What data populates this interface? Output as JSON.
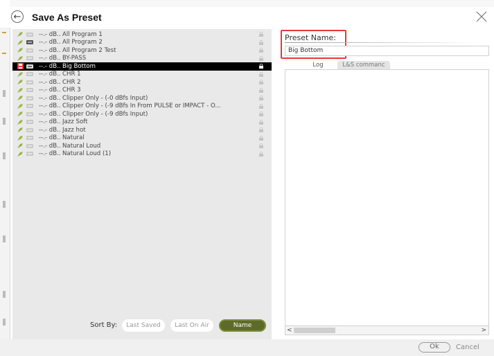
{
  "dialog": {
    "title": "Save As Preset",
    "back_icon": "back-arrow-icon",
    "close_icon": "close-icon"
  },
  "presets": [
    {
      "level": "--.- dB..",
      "name": "All Program 1",
      "selected": false
    },
    {
      "level": "--.- dB..",
      "name": "All Program 2",
      "selected": false
    },
    {
      "level": "--.- dB..",
      "name": "All Program 2 Test",
      "selected": false
    },
    {
      "level": "--.- dB..",
      "name": "BY-PASS",
      "selected": false
    },
    {
      "level": "--.- dB..",
      "name": "Big Bottom",
      "selected": true
    },
    {
      "level": "--.- dB..",
      "name": "CHR 1",
      "selected": false
    },
    {
      "level": "--.- dB..",
      "name": "CHR 2",
      "selected": false
    },
    {
      "level": "--.- dB..",
      "name": "CHR 3",
      "selected": false
    },
    {
      "level": "--.- dB..",
      "name": "Clipper Only - (-0 dBfs Input)",
      "selected": false
    },
    {
      "level": "--.- dB..",
      "name": "Clipper Only - (-9 dBfs In From PULSE or IMPACT - O...",
      "selected": false
    },
    {
      "level": "--.- dB..",
      "name": "Clipper Only - (-9 dBfs Input)",
      "selected": false
    },
    {
      "level": "--.- dB..",
      "name": "Jazz Soft",
      "selected": false
    },
    {
      "level": "--.- dB..",
      "name": "Jazz hot",
      "selected": false
    },
    {
      "level": "--.- dB..",
      "name": "Natural",
      "selected": false
    },
    {
      "level": "--.- dB..",
      "name": "Natural Loud",
      "selected": false
    },
    {
      "level": "--.- dB..",
      "name": "Natural Loud (1)",
      "selected": false
    }
  ],
  "sort": {
    "label": "Sort By:",
    "options": [
      {
        "label": "Last Saved",
        "active": false
      },
      {
        "label": "Last On Air",
        "active": false
      },
      {
        "label": "Name",
        "active": true
      }
    ]
  },
  "preset_name": {
    "label": "Preset Name:",
    "value": "Big Bottom"
  },
  "tabs": [
    {
      "label": "Log",
      "active": true
    },
    {
      "label": "L&S commanc",
      "active": false
    }
  ],
  "scrollbar": {
    "left_arrow": "<",
    "right_arrow": ">"
  },
  "footer": {
    "ok_label": "Ok",
    "cancel_label": "Cancel"
  },
  "colors": {
    "highlight": "#e53935",
    "sort_active": "#5d6b2a",
    "leaf_icon": "#8ab83a"
  }
}
